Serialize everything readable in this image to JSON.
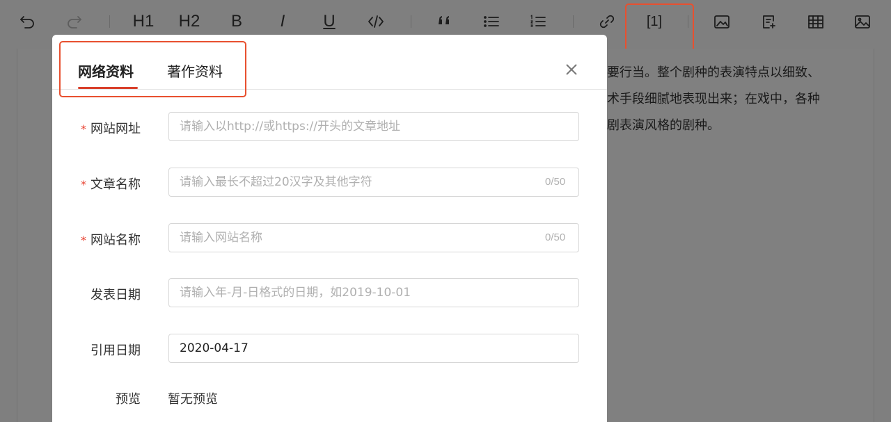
{
  "toolbar": {
    "h1": "H1",
    "h2": "H2",
    "bold": "B",
    "italic": "I",
    "underline": "U",
    "citation": "[1]"
  },
  "document": {
    "lines": [
      "要行当。整个剧种的表演特点以细致、",
      "术手段细腻地表现出来；在戏中，各种",
      "剧表演风格的剧种。"
    ]
  },
  "dialog": {
    "tabs": [
      {
        "label": "网络资料",
        "active": true
      },
      {
        "label": "著作资料",
        "active": false
      }
    ],
    "fields": {
      "site_url": {
        "label": "网站网址",
        "required": true,
        "placeholder": "请输入以http://或https://开头的文章地址",
        "value": ""
      },
      "article_name": {
        "label": "文章名称",
        "required": true,
        "placeholder": "请输入最长不超过20汉字及其他字符",
        "value": "",
        "counter": "0/50"
      },
      "site_name": {
        "label": "网站名称",
        "required": true,
        "placeholder": "请输入网站名称",
        "value": "",
        "counter": "0/50"
      },
      "publish_date": {
        "label": "发表日期",
        "required": false,
        "placeholder": "请输入年-月-日格式的日期，如2019-10-01",
        "value": ""
      },
      "cite_date": {
        "label": "引用日期",
        "required": false,
        "placeholder": "",
        "value": "2020-04-17"
      }
    },
    "preview": {
      "label": "预览",
      "value": "暂无预览"
    },
    "required_mark": "*"
  },
  "colors": {
    "accent": "#d9402b",
    "highlight": "#e8502f",
    "overlay": "#7f7f7f"
  }
}
